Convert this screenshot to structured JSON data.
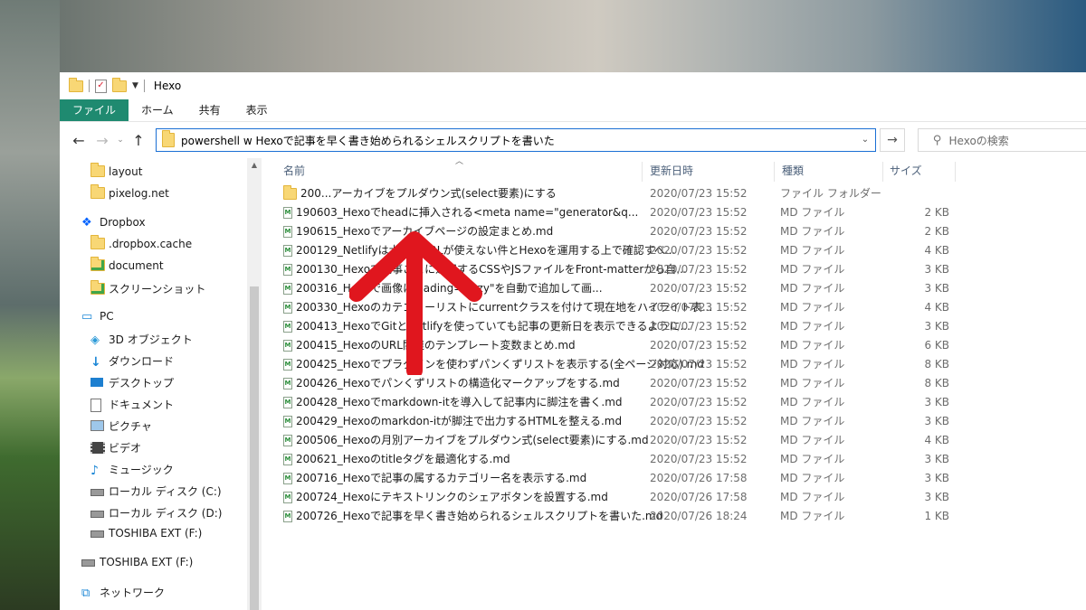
{
  "window": {
    "title": "Hexo",
    "ribbon_tabs": [
      "ファイル",
      "ホーム",
      "共有",
      "表示"
    ],
    "address_path": "powershell w Hexoで記事を早く書き始められるシェルスクリプトを書いた",
    "search_placeholder": "Hexoの検索"
  },
  "sidebar": {
    "items": [
      {
        "label": "layout",
        "icon": "folder-icon"
      },
      {
        "label": "pixelog.net",
        "icon": "folder-icon"
      },
      {
        "label": "Dropbox",
        "icon": "dropbox-icon"
      },
      {
        "label": ".dropbox.cache",
        "icon": "folder-icon"
      },
      {
        "label": "document",
        "icon": "synced-folder-icon"
      },
      {
        "label": "スクリーンショット",
        "icon": "synced-folder-icon"
      },
      {
        "label": "PC",
        "icon": "pc-icon"
      },
      {
        "label": "3D オブジェクト",
        "icon": "cube-icon"
      },
      {
        "label": "ダウンロード",
        "icon": "download-icon"
      },
      {
        "label": "デスクトップ",
        "icon": "desktop-icon"
      },
      {
        "label": "ドキュメント",
        "icon": "document-icon"
      },
      {
        "label": "ピクチャ",
        "icon": "picture-icon"
      },
      {
        "label": "ビデオ",
        "icon": "video-icon"
      },
      {
        "label": "ミュージック",
        "icon": "music-icon"
      },
      {
        "label": "ローカル ディスク (C:)",
        "icon": "drive-icon"
      },
      {
        "label": "ローカル ディスク (D:)",
        "icon": "drive-icon"
      },
      {
        "label": "TOSHIBA EXT (F:)",
        "icon": "drive-icon"
      },
      {
        "label": "TOSHIBA EXT (F:)",
        "icon": "drive-icon"
      },
      {
        "label": "ネットワーク",
        "icon": "network-icon"
      }
    ]
  },
  "columns": {
    "name": "名前",
    "date": "更新日時",
    "type": "種類",
    "size": "サイズ"
  },
  "files": [
    {
      "name": "200...",
      "suffix": "アーカイブをプルダウン式(select要素)にする",
      "date": "2020/07/23 15:52",
      "type": "ファイル フォルダー",
      "size": "",
      "icon": "folder"
    },
    {
      "name": "190603_Hexo",
      "suffix": "でheadに挿入される&lt;meta name=&quot;generator&q...",
      "date": "2020/07/23 15:52",
      "type": "MD ファイル",
      "size": "2 KB",
      "icon": "md"
    },
    {
      "name": "190615_Hexo",
      "suffix": "でアーカイブページの設定まとめ.md",
      "date": "2020/07/23 15:52",
      "type": "MD ファイル",
      "size": "2 KB",
      "icon": "md"
    },
    {
      "name": "200129_Netlify",
      "suffix": "は大文字URLが使えない件とHexoを運用する上で確認すべ...",
      "date": "2020/07/23 15:52",
      "type": "MD ファイル",
      "size": "4 KB",
      "icon": "md"
    },
    {
      "name": "200130_Hexo",
      "suffix": "で記事ごとに適用するCSSやJSファイルをFront-matterから自...",
      "date": "2020/07/23 15:52",
      "type": "MD ファイル",
      "size": "3 KB",
      "icon": "md"
    },
    {
      "name": "200316_Hexo",
      "suffix": "で画像にloading=&quot;lazy&quot;を自動で追加して画...",
      "date": "2020/07/23 15:52",
      "type": "MD ファイル",
      "size": "3 KB",
      "icon": "md"
    },
    {
      "name": "200330_Hexoのカテゴリーリストにcurrentクラスを付けて現在地をハイライト表...",
      "suffix": "",
      "date": "2020/07/23 15:52",
      "type": "MD ファイル",
      "size": "4 KB",
      "icon": "md"
    },
    {
      "name": "200413_HexoでGitとNetlifyを使っていても記事の更新日を表示できるように...",
      "suffix": "",
      "date": "2020/07/23 15:52",
      "type": "MD ファイル",
      "size": "3 KB",
      "icon": "md"
    },
    {
      "name": "200415_HexoのURL関連のテンプレート変数まとめ.md",
      "suffix": "",
      "date": "2020/07/23 15:52",
      "type": "MD ファイル",
      "size": "6 KB",
      "icon": "md"
    },
    {
      "name": "200425_Hexoでプラグインを使わずパンくずリストを表示する(全ページ対応).md",
      "suffix": "",
      "date": "2020/07/23 15:52",
      "type": "MD ファイル",
      "size": "8 KB",
      "icon": "md"
    },
    {
      "name": "200426_Hexoでパンくずリストの構造化マークアップをする.md",
      "suffix": "",
      "date": "2020/07/23 15:52",
      "type": "MD ファイル",
      "size": "8 KB",
      "icon": "md"
    },
    {
      "name": "200428_Hexoでmarkdown-itを導入して記事内に脚注を書く.md",
      "suffix": "",
      "date": "2020/07/23 15:52",
      "type": "MD ファイル",
      "size": "3 KB",
      "icon": "md"
    },
    {
      "name": "200429_Hexoのmarkdon-itが脚注で出力するHTMLを整える.md",
      "suffix": "",
      "date": "2020/07/23 15:52",
      "type": "MD ファイル",
      "size": "3 KB",
      "icon": "md"
    },
    {
      "name": "200506_Hexoの月別アーカイブをプルダウン式(select要素)にする.md",
      "suffix": "",
      "date": "2020/07/23 15:52",
      "type": "MD ファイル",
      "size": "4 KB",
      "icon": "md"
    },
    {
      "name": "200621_Hexoのtitleタグを最適化する.md",
      "suffix": "",
      "date": "2020/07/23 15:52",
      "type": "MD ファイル",
      "size": "3 KB",
      "icon": "md"
    },
    {
      "name": "200716_Hexoで記事の属するカテゴリー名を表示する.md",
      "suffix": "",
      "date": "2020/07/26 17:58",
      "type": "MD ファイル",
      "size": "3 KB",
      "icon": "md"
    },
    {
      "name": "200724_Hexoにテキストリンクのシェアボタンを設置する.md",
      "suffix": "",
      "date": "2020/07/26 17:58",
      "type": "MD ファイル",
      "size": "3 KB",
      "icon": "md"
    },
    {
      "name": "200726_Hexoで記事を早く書き始められるシェルスクリプトを書いた.md",
      "suffix": "",
      "date": "2020/07/26 18:24",
      "type": "MD ファイル",
      "size": "1 KB",
      "icon": "md"
    }
  ],
  "colors": {
    "accent": "#1f8a70",
    "address_border": "#1a6fd4",
    "arrow": "#e0161e"
  }
}
